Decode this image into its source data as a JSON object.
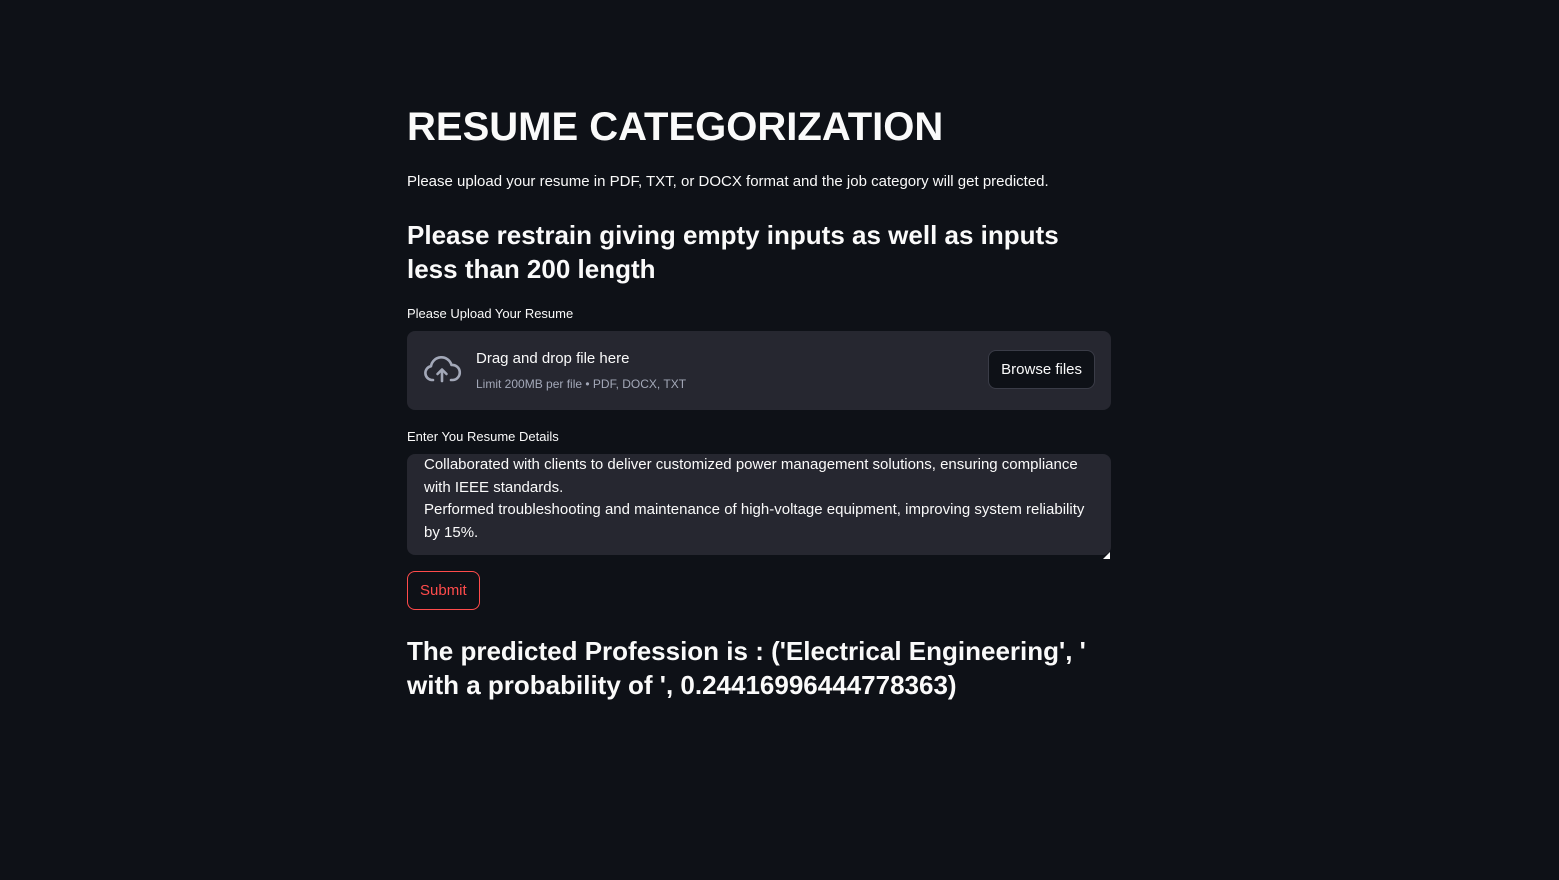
{
  "page": {
    "title": "RESUME CATEGORIZATION",
    "intro": "Please upload your resume in PDF, TXT, or DOCX format and the job category will get predicted.",
    "warning": "Please restrain giving empty inputs as well as inputs less than 200 length"
  },
  "uploader": {
    "label": "Please Upload Your Resume",
    "drop_title": "Drag and drop file here",
    "limit_text": "Limit 200MB per file • PDF, DOCX, TXT",
    "browse_label": "Browse files",
    "icon": "cloud-upload-icon"
  },
  "details": {
    "label": "Enter You Resume Details",
    "value": "Collaborated with clients to deliver customized power management solutions, ensuring compliance with IEEE standards.\nPerformed troubleshooting and maintenance of high-voltage equipment, improving system reliability by 15%."
  },
  "submit": {
    "label": "Submit"
  },
  "result": {
    "text": "The predicted Profession is : ('Electrical Engineering', ' with a probability of ', 0.24416996444778363)"
  },
  "colors": {
    "background": "#0e1117",
    "surface": "#262730",
    "accent": "#ff4b4b",
    "text": "#fafafa",
    "muted": "#a3a8b8"
  }
}
